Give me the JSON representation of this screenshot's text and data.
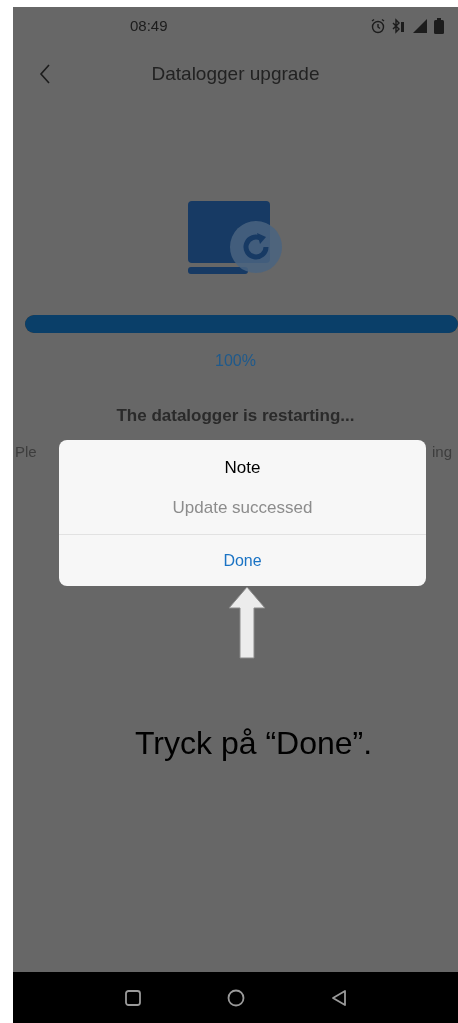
{
  "status_bar": {
    "time": "08:49"
  },
  "header": {
    "title": "Datalogger upgrade"
  },
  "progress": {
    "level": 1,
    "reading": "100%"
  },
  "status_message": "The datalogger is restarting...",
  "hint_visible_parts": [
    "Ple",
    "ing"
  ],
  "dialog": {
    "title": "Note",
    "message": "Update successed",
    "button": "Done"
  },
  "annotation": {
    "text": "Tryck på “Done”."
  }
}
